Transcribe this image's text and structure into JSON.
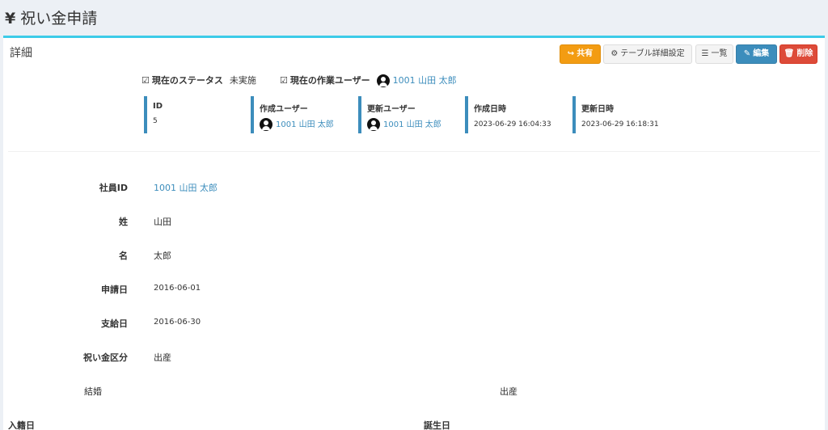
{
  "header": {
    "icon": "yen-icon",
    "title": "祝い金申請"
  },
  "box": {
    "title": "詳細",
    "accent_color": "#3ccbe8"
  },
  "toolbar": {
    "share_label": "共有",
    "table_settings_label": "テーブル詳細設定",
    "list_label": "一覧",
    "edit_label": "編集",
    "delete_label": "削除"
  },
  "status": {
    "current_status_label": "現在のステータス",
    "current_status_value": "未実施",
    "current_user_label": "現在の作業ユーザー",
    "current_user_value": "1001 山田 太郎"
  },
  "info": {
    "id_label": "ID",
    "id_value": "5",
    "created_by_label": "作成ユーザー",
    "created_by_value": "1001 山田 太郎",
    "updated_by_label": "更新ユーザー",
    "updated_by_value": "1001 山田 太郎",
    "created_at_label": "作成日時",
    "created_at_value": "2023-06-29 16:04:33",
    "updated_at_label": "更新日時",
    "updated_at_value": "2023-06-29 16:18:31"
  },
  "fields": {
    "employee_id_label": "社員ID",
    "employee_id_value": "1001 山田 太郎",
    "last_name_label": "姓",
    "last_name_value": "山田",
    "first_name_label": "名",
    "first_name_value": "太郎",
    "apply_date_label": "申請日",
    "apply_date_value": "2016-06-01",
    "pay_date_label": "支給日",
    "pay_date_value": "2016-06-30",
    "category_label": "祝い金区分",
    "category_value": "出産"
  },
  "options": {
    "marriage": "結婚",
    "birth": "出産"
  },
  "bottom": {
    "registration_date_label": "入籍日",
    "birth_date_label": "誕生日"
  },
  "colors": {
    "share": "#f39c12",
    "edit": "#3c8dbc",
    "delete": "#dd4b39",
    "link": "#3c8dbc"
  }
}
